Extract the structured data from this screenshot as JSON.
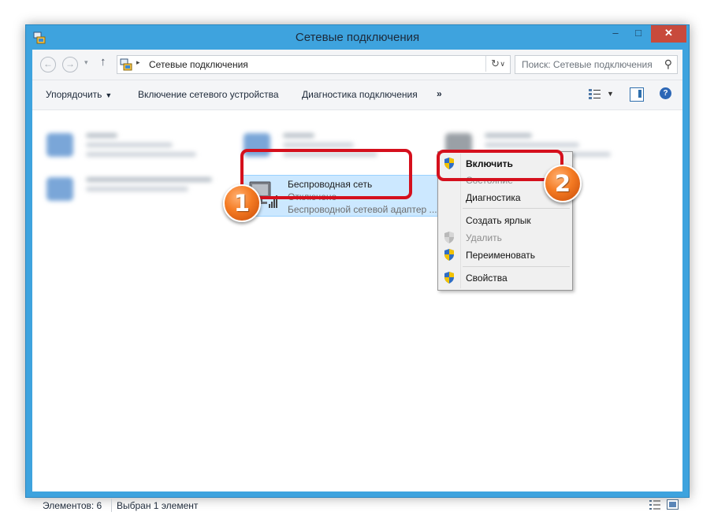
{
  "window": {
    "title": "Сетевые подключения",
    "controls": {
      "minimize": "–",
      "maximize": "□",
      "close": "✕"
    }
  },
  "nav": {
    "back_icon": "arrow-left-icon",
    "forward_icon": "arrow-right-icon",
    "up_symbol": "↑",
    "recent_symbol": "▾"
  },
  "address": {
    "separator": "▸",
    "path": "Сетевые подключения",
    "dropdown_symbol": "∨",
    "refresh_symbol": "↻"
  },
  "search": {
    "placeholder": "Поиск: Сетевые подключения",
    "icon_symbol": "⚲"
  },
  "toolbar": {
    "organize": "Упорядочить",
    "organize_caret": "▼",
    "enable_device": "Включение сетевого устройства",
    "diagnostics": "Диагностика подключения",
    "more": "»",
    "view_caret": "▼",
    "help": "?"
  },
  "selected_item": {
    "name": "Беспроводная сеть",
    "status": "Отключено",
    "adapter": "Беспроводной сетевой адаптер ..."
  },
  "context_menu": {
    "items": [
      {
        "label": "Включить",
        "bold": true,
        "disabled": false,
        "shield": true
      },
      {
        "label": "Состояние",
        "bold": false,
        "disabled": true,
        "shield": false
      },
      {
        "label": "Диагностика",
        "bold": false,
        "disabled": false,
        "shield": false
      },
      {
        "label": "Создать ярлык",
        "bold": false,
        "disabled": false,
        "shield": false
      },
      {
        "label": "Удалить",
        "bold": false,
        "disabled": true,
        "shield": true
      },
      {
        "label": "Переименовать",
        "bold": false,
        "disabled": false,
        "shield": true
      },
      {
        "label": "Свойства",
        "bold": false,
        "disabled": false,
        "shield": true
      }
    ]
  },
  "annotations": {
    "step1": "1",
    "step2": "2"
  },
  "statusbar": {
    "count": "Элементов: 6",
    "selected": "Выбран 1 элемент"
  },
  "colors": {
    "window_frame": "#3ea3de",
    "selection_fill": "#cce8ff",
    "highlight": "#d5101d",
    "badge": "#f47a22"
  }
}
